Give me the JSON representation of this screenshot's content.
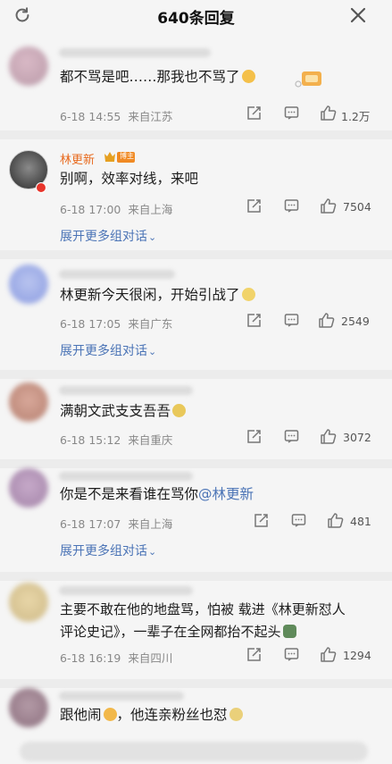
{
  "header": {
    "title": "640条回复"
  },
  "comments": [
    {
      "text": "都不骂是吧……那我也不骂了",
      "date": "6-18 14:55",
      "location": "来自江苏",
      "likes": "1.2万"
    },
    {
      "name": "林更新",
      "badge": "博主",
      "text": "别啊，效率对线，来吧",
      "date": "6-18 17:00",
      "location": "来自上海",
      "likes": "7504",
      "expand": "展开更多组对话"
    },
    {
      "text": "林更新今天很闲，开始引战了",
      "date": "6-18 17:05",
      "location": "来自广东",
      "likes": "2549",
      "expand": "展开更多组对话"
    },
    {
      "text": "满朝文武支支吾吾",
      "date": "6-18 15:12",
      "location": "来自重庆",
      "likes": "3072"
    },
    {
      "text": "你是不是来看谁在骂你",
      "mention": "@林更新",
      "date": "6-18 17:07",
      "location": "来自上海",
      "likes": "481",
      "expand": "展开更多组对话"
    },
    {
      "text_line1": "主要不敢在他的地盘骂，怕被 载进《林更新怼人",
      "text_line2": "评论史记》，一辈子在全网都抬不起头",
      "date": "6-18 16:19",
      "location": "来自四川",
      "likes": "1294"
    },
    {
      "text_a": "跟他闹",
      "text_b": "，他连亲粉丝也怼"
    }
  ],
  "colors": {
    "name": "#e86a1e",
    "link": "#4b74b6",
    "meta": "#888888",
    "text": "#1c1c1c"
  },
  "icons": [
    "refresh-icon",
    "close-icon",
    "share-icon",
    "comment-icon",
    "like-icon",
    "chevron-down-icon"
  ]
}
